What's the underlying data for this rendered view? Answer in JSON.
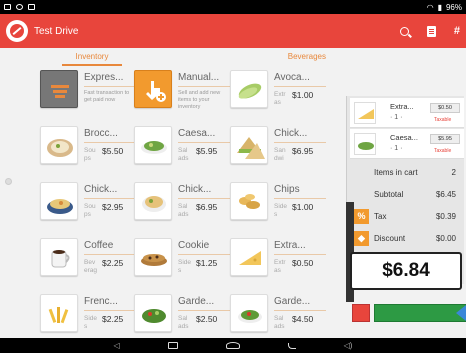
{
  "status_bar": {
    "left_icons": [
      "screenshot-icon",
      "sync-icon",
      "image-icon"
    ],
    "battery_text": "96%"
  },
  "app": {
    "title": "Test Drive",
    "accent_color": "#e8453c"
  },
  "tabs": [
    {
      "label": "Inventory"
    },
    {
      "label": "Beverages"
    }
  ],
  "tiles": [
    {
      "name": "Expres...",
      "desc": "Fast transaction to get paid now",
      "icon": "express-icon"
    },
    {
      "name": "Manual...",
      "desc": "Sell and add new items to your inventory",
      "icon": "manual-add-icon"
    },
    {
      "name": "Avoca...",
      "cat": "Extr",
      "price": "$1.00",
      "cont": "as",
      "icon": "avocado-icon"
    },
    {
      "name": "Brocc...",
      "cat": "Sou",
      "price": "$5.50",
      "cont": "ps",
      "icon": "broccoli-soup-icon"
    },
    {
      "name": "Caesa...",
      "cat": "Sal",
      "price": "$5.95",
      "cont": "ads",
      "icon": "caesar-salad-icon"
    },
    {
      "name": "Chick...",
      "cat": "San",
      "price": "$6.95",
      "cont": "dwi",
      "icon": "chicken-sandwich-icon"
    },
    {
      "name": "Chick...",
      "cat": "Sou",
      "price": "$2.95",
      "cont": "ps",
      "icon": "chicken-soup-icon"
    },
    {
      "name": "Chick...",
      "cat": "Sal",
      "price": "$6.95",
      "cont": "ads",
      "icon": "chicken-salad-icon"
    },
    {
      "name": "Chips",
      "cat": "Side",
      "price": "$1.00",
      "cont": "s",
      "icon": "chips-icon"
    },
    {
      "name": "Coffee",
      "cat": "Bev",
      "price": "$2.25",
      "cont": "erag",
      "icon": "coffee-icon"
    },
    {
      "name": "Cookie",
      "cat": "Side",
      "price": "$1.25",
      "cont": "s",
      "icon": "cookie-icon"
    },
    {
      "name": "Extra...",
      "cat": "Extr",
      "price": "$0.50",
      "cont": "as",
      "icon": "cheese-icon"
    },
    {
      "name": "Frenc...",
      "cat": "Side",
      "price": "$2.25",
      "cont": "s",
      "icon": "fries-icon"
    },
    {
      "name": "Garde...",
      "cat": "Sal",
      "price": "$2.50",
      "cont": "ads",
      "icon": "garden-salad-icon"
    },
    {
      "name": "Garde...",
      "cat": "Sal",
      "price": "$4.50",
      "cont": "ads",
      "icon": "garden-salad-large-icon"
    }
  ],
  "cart": {
    "items": [
      {
        "name": "Extra...",
        "qty": "1",
        "price": "$0.50",
        "taxable": "Taxable",
        "icon": "cheese-icon"
      },
      {
        "name": "Caesa...",
        "qty": "1",
        "price": "$5.95",
        "taxable": "Taxable",
        "icon": "caesar-salad-icon"
      }
    ],
    "items_in_cart_label": "Items in cart",
    "items_in_cart": "2",
    "subtotal_label": "Subtotal",
    "subtotal": "$6.45",
    "tax_label": "Tax",
    "tax": "$0.39",
    "discount_label": "Discount",
    "discount": "$0.00",
    "total": "$6.84"
  },
  "colors": {
    "accent": "#e8453c",
    "tab": "#e8883c",
    "pay": "#2d9a44",
    "badge": "#f29a2e"
  }
}
